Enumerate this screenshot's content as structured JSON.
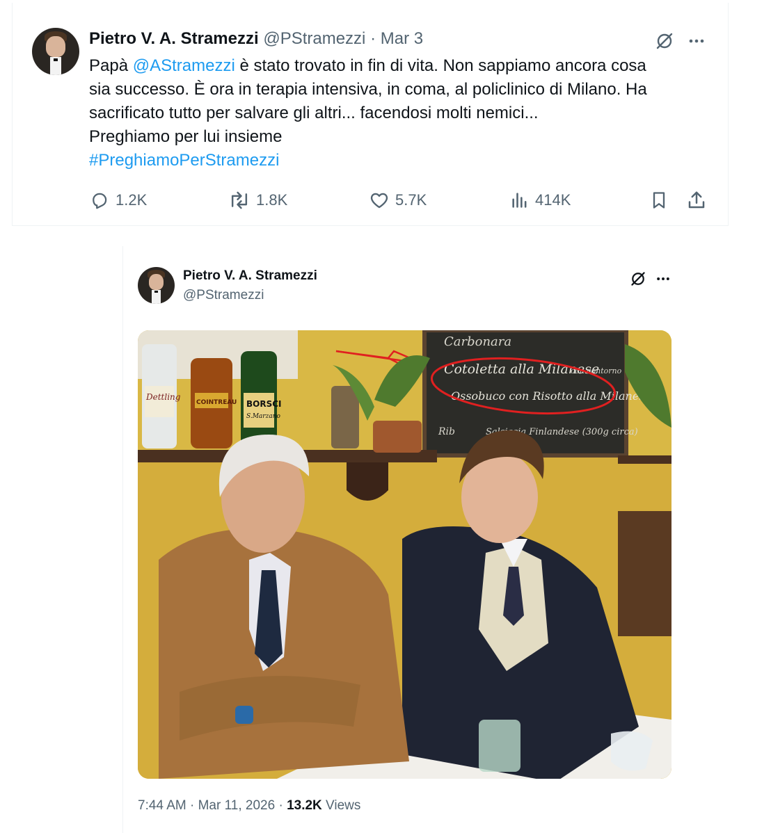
{
  "main_tweet": {
    "author_name": "Pietro V. A. Stramezzi",
    "handle": "@PStramezzi",
    "separator": "·",
    "date": "Mar 3",
    "text_lines": {
      "l1_pre": "Papà ",
      "mention": "@AStramezzi",
      "l1_post": " è stato trovato in fin di vita. Non sappiamo ancora cosa",
      "l2": "sia successo. È ora in terapia intensiva, in coma, al policlinico di Milano. Ha",
      "l3": "sacrificato tutto per salvare gli altri... facendosi molti nemici...",
      "l4": "Preghiamo per lui insieme"
    },
    "hashtag": "#PreghiamoPerStramezzi",
    "stats": {
      "replies": "1.2K",
      "reposts": "1.8K",
      "likes": "5.7K",
      "views": "414K"
    },
    "icons": [
      "grok-icon",
      "more-icon",
      "reply-icon",
      "repost-icon",
      "like-icon",
      "views-icon",
      "bookmark-icon",
      "share-icon"
    ]
  },
  "quoted_tweet": {
    "author_name": "Pietro V. A. Stramezzi",
    "handle": "@PStramezzi",
    "photo_text": {
      "line0": "Carbonara",
      "line1": "Cotoletta alla Milanese",
      "line1b": "con contorno",
      "line2": "Ossobuco con Risotto alla Milanese",
      "line3": "Rib",
      "line3b": "Salsiccia Finlandese (300g circa)",
      "bottle1": "Dettling",
      "bottle2": "COINTREAU",
      "bottle3": "BORSCI",
      "bottle3b": "S.Marzano"
    },
    "time": "7:44 AM",
    "separator": "·",
    "date": "Mar 11, 2026",
    "views_count": "13.2K",
    "views_label": "Views"
  },
  "colors": {
    "link": "#1d9bf0",
    "muted": "#536471",
    "text": "#0f1419",
    "annotation_red": "#e02020"
  }
}
